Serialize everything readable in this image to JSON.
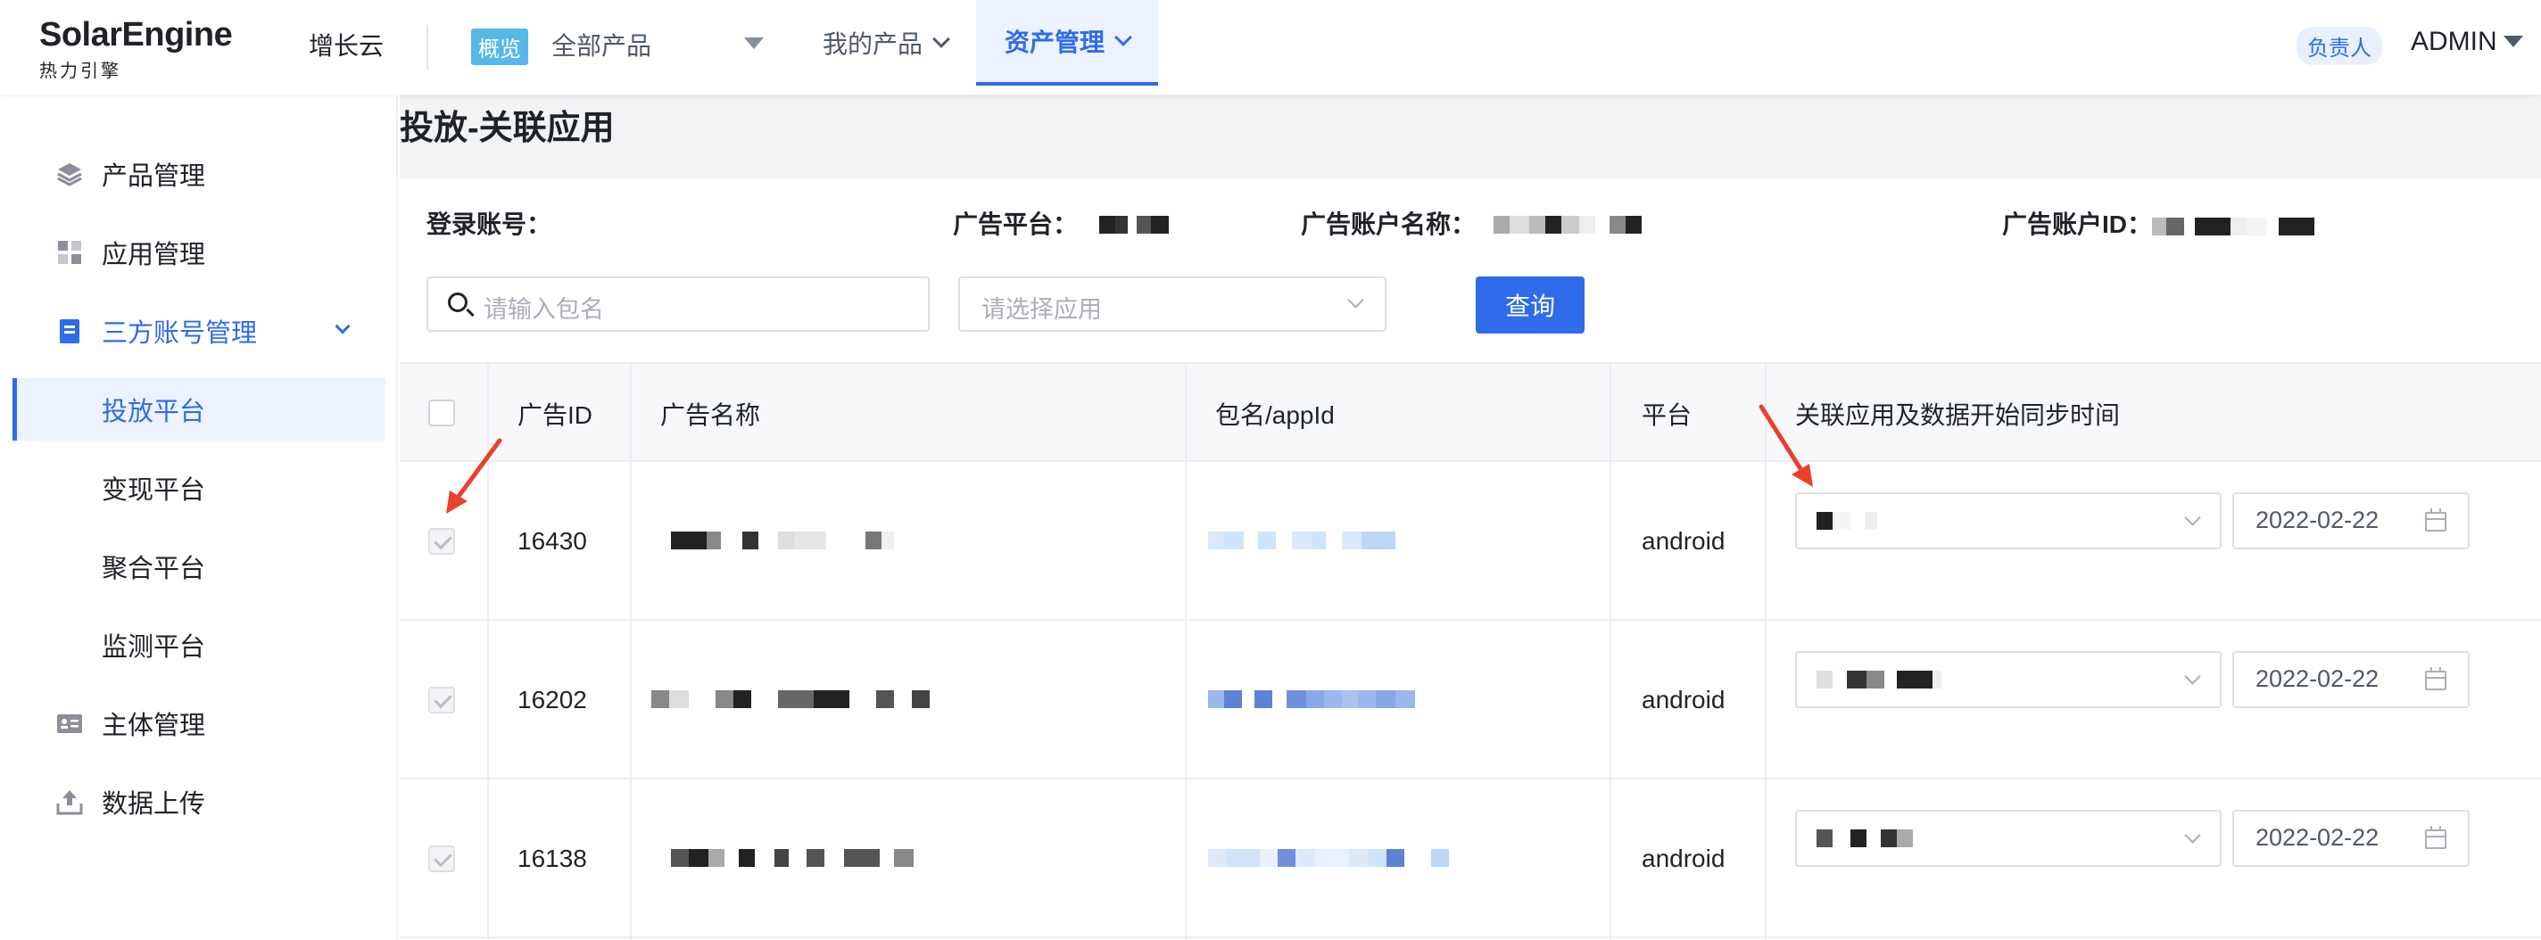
{
  "header": {
    "logo_main": "SolarEngine",
    "logo_sub": "热力引擎",
    "growth": "增长云",
    "overview_badge": "概览",
    "all_products": "全部产品",
    "nav_my_products": "我的产品",
    "nav_asset_management": "资产管理",
    "owner_badge": "负责人",
    "user": "ADMIN"
  },
  "sidebar": {
    "items": [
      {
        "label": "产品管理",
        "icon": "layers-icon"
      },
      {
        "label": "应用管理",
        "icon": "apps-grid-icon"
      },
      {
        "label": "三方账号管理",
        "icon": "clipboard-icon"
      },
      {
        "label": "投放平台"
      },
      {
        "label": "变现平台"
      },
      {
        "label": "聚合平台"
      },
      {
        "label": "监测平台"
      },
      {
        "label": "主体管理",
        "icon": "id-card-icon"
      },
      {
        "label": "数据上传",
        "icon": "upload-icon"
      }
    ]
  },
  "page": {
    "title": "投放-关联应用"
  },
  "filters": {
    "login_account_label": "登录账号：",
    "ad_platform_label": "广告平台：",
    "ad_account_name_label": "广告账户名称：",
    "ad_account_id_label": "广告账户ID：",
    "search_placeholder": "请输入包名",
    "app_select_placeholder": "请选择应用",
    "query_button": "查询"
  },
  "table": {
    "headers": {
      "ad_id": "广告ID",
      "ad_name": "广告名称",
      "package": "包名/appId",
      "platform": "平台",
      "linked_app": "关联应用及数据开始同步时间"
    },
    "rows": [
      {
        "ad_id": "16430",
        "platform": "android",
        "date": "2022-02-22",
        "checked": true
      },
      {
        "ad_id": "16202",
        "platform": "android",
        "date": "2022-02-22",
        "checked": true
      },
      {
        "ad_id": "16138",
        "platform": "android",
        "date": "2022-02-22",
        "checked": true
      }
    ]
  },
  "colors": {
    "accent": "#2f6bea",
    "overview_badge": "#57b7e9",
    "annotation_arrow": "#e8412c"
  }
}
